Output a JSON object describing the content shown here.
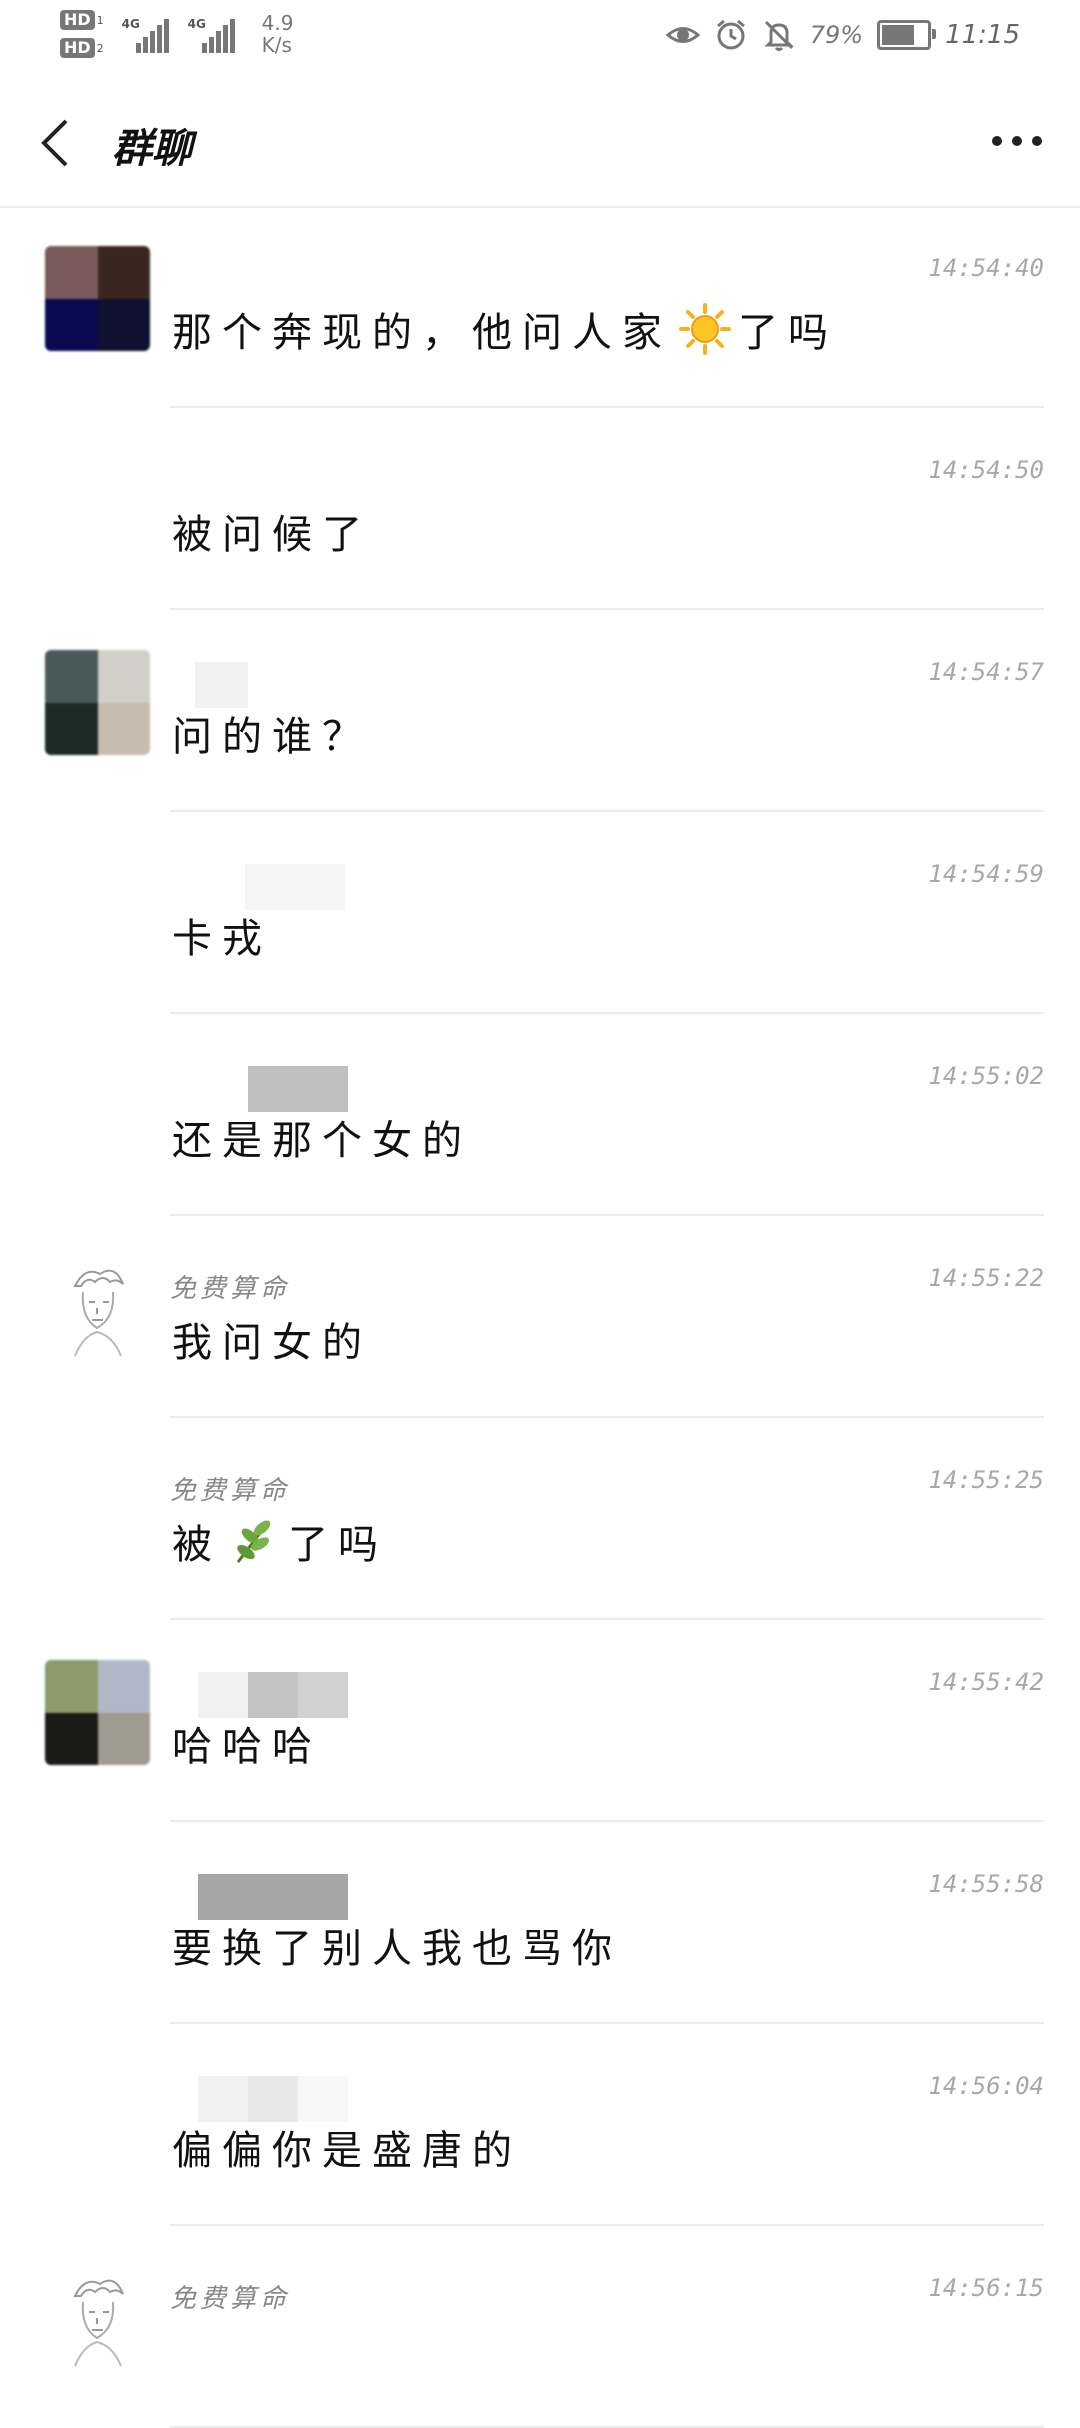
{
  "status_bar": {
    "hd1": "HD",
    "hd1_sub": "1",
    "hd2": "HD",
    "hd2_sub": "2",
    "net1": "4G",
    "net2": "4G",
    "speed_value": "4.9",
    "speed_unit": "K/s",
    "battery_percent": "79%",
    "battery_level": 0.79,
    "time": "11:15",
    "icons": [
      "eye-icon",
      "alarm-icon",
      "mute-bell-icon",
      "battery-icon"
    ]
  },
  "header": {
    "title": "群聊",
    "back_icon": "chevron-left-icon",
    "more_icon": "more-dots-icon"
  },
  "messages": [
    {
      "sender": "",
      "time": "14:54:40",
      "text_before": "那个奔现的，他问人家",
      "emoji": "sun-emoji",
      "text_after": "了吗",
      "avatar": "blurred-avatar",
      "avatar_colors": [
        "#7a5a5a",
        "#3a2620",
        "#0a0a50",
        "#101030"
      ]
    },
    {
      "sender": "",
      "time": "14:54:50",
      "text_before": "被问候了",
      "emoji": "",
      "text_after": "",
      "avatar": ""
    },
    {
      "sender": "",
      "time": "14:54:57",
      "text_before": "问的谁？",
      "emoji": "",
      "text_after": "",
      "avatar": "blurred-avatar",
      "avatar_colors": [
        "#4a5a5a",
        "#d0cfc8",
        "#1e2a26",
        "#c8bcb0"
      ]
    },
    {
      "sender": "",
      "time": "14:54:59",
      "text_before": "卡戎",
      "emoji": "",
      "text_after": "",
      "avatar": ""
    },
    {
      "sender": "",
      "time": "14:55:02",
      "text_before": "还是那个女的",
      "emoji": "",
      "text_after": "",
      "avatar": ""
    },
    {
      "sender": "免费算命",
      "time": "14:55:22",
      "text_before": "我问女的",
      "emoji": "",
      "text_after": "",
      "avatar": "sketch-avatar"
    },
    {
      "sender": "免费算命",
      "time": "14:55:25",
      "text_before": "被",
      "emoji": "leaf-emoji",
      "text_after": "了吗",
      "avatar": ""
    },
    {
      "sender": "",
      "time": "14:55:42",
      "text_before": "哈哈哈",
      "emoji": "",
      "text_after": "",
      "avatar": "blurred-avatar",
      "avatar_colors": [
        "#8a9a6a",
        "#b0b8c8",
        "#1a1a16",
        "#a09a90"
      ]
    },
    {
      "sender": "",
      "time": "14:55:58",
      "text_before": "要换了别人我也骂你",
      "emoji": "",
      "text_after": "",
      "avatar": ""
    },
    {
      "sender": "",
      "time": "14:56:04",
      "text_before": "偏偏你是盛唐的",
      "emoji": "",
      "text_after": "",
      "avatar": ""
    },
    {
      "sender": "免费算命",
      "time": "14:56:15",
      "text_before": "",
      "emoji": "",
      "text_after": "",
      "avatar": "sketch-avatar"
    }
  ]
}
